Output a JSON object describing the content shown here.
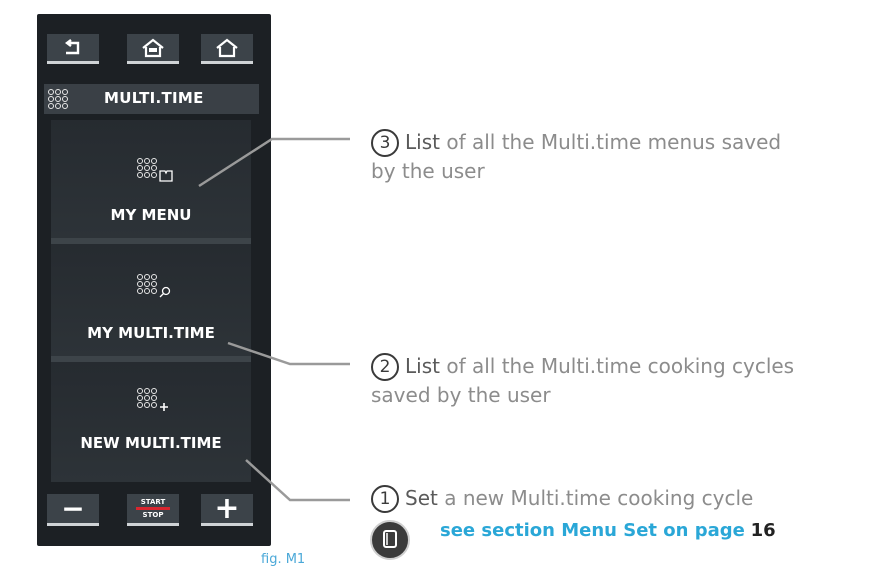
{
  "panel": {
    "header": {
      "title": "MULTI.TIME"
    },
    "tiles": [
      {
        "label": "MY MENU"
      },
      {
        "label": "MY MULTI.TIME"
      },
      {
        "label": "NEW MULTI.TIME"
      }
    ],
    "top_buttons": [
      "back-icon",
      "home-menu-icon",
      "home-icon"
    ],
    "bottom": {
      "start": "START",
      "stop": "STOP",
      "minus": "−",
      "plus": "+"
    }
  },
  "callouts": [
    {
      "num": "3",
      "bold": "List",
      "text": " of all the Multi.time menus saved",
      "line2": "by the user"
    },
    {
      "num": "2",
      "bold": "List",
      "text": " of all the Multi.time cooking cycles",
      "line2": "saved by the user"
    },
    {
      "num": "1",
      "bold": "Set",
      "text": " a new Multi.time cooking cycle"
    }
  ],
  "reference": {
    "text": "see section Menu Set on page",
    "page": "16"
  },
  "caption": "fig. M1",
  "colors": {
    "panel": "#1c2024",
    "link": "#2aa7d7",
    "accent_red": "#d9262f"
  }
}
